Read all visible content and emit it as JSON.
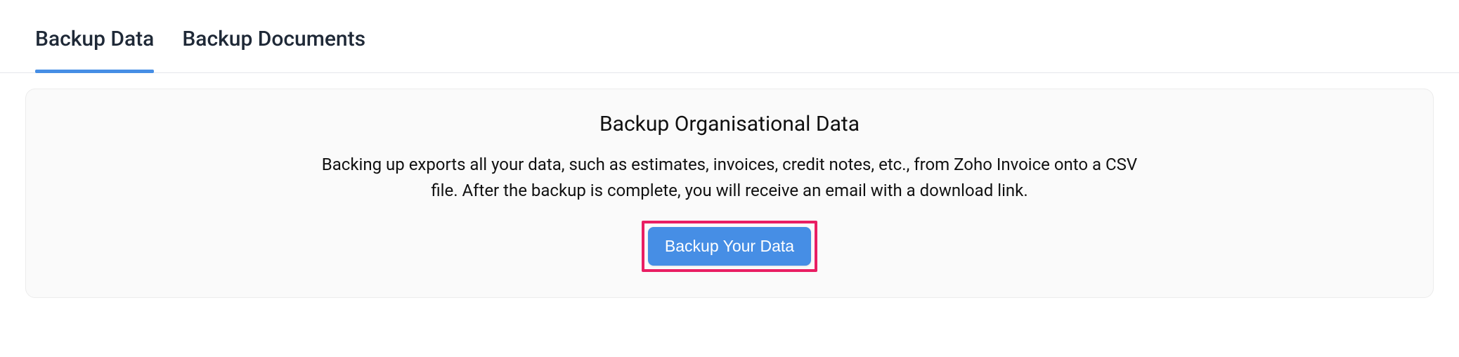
{
  "tabs": {
    "items": [
      {
        "label": "Backup Data",
        "active": true
      },
      {
        "label": "Backup Documents",
        "active": false
      }
    ]
  },
  "card": {
    "title": "Backup Organisational Data",
    "description": "Backing up exports all your data, such as estimates, invoices, credit notes, etc., from Zoho Invoice onto a CSV file. After the backup is complete, you will receive an email with a download link.",
    "button_label": "Backup Your Data"
  },
  "colors": {
    "accent": "#468ee5",
    "highlight_border": "#e91e63"
  }
}
